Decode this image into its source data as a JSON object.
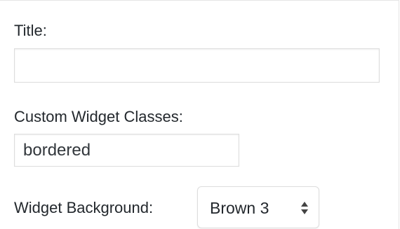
{
  "form": {
    "title_label": "Title:",
    "title_value": "",
    "classes_label": "Custom Widget Classes:",
    "classes_value": "bordered",
    "background_label": "Widget Background:",
    "background_selected": "Brown 3"
  },
  "icons": {
    "select_arrows": "chevron-up-down-icon"
  },
  "colors": {
    "text": "#23282d",
    "border": "#dddddd",
    "background": "#ffffff"
  }
}
